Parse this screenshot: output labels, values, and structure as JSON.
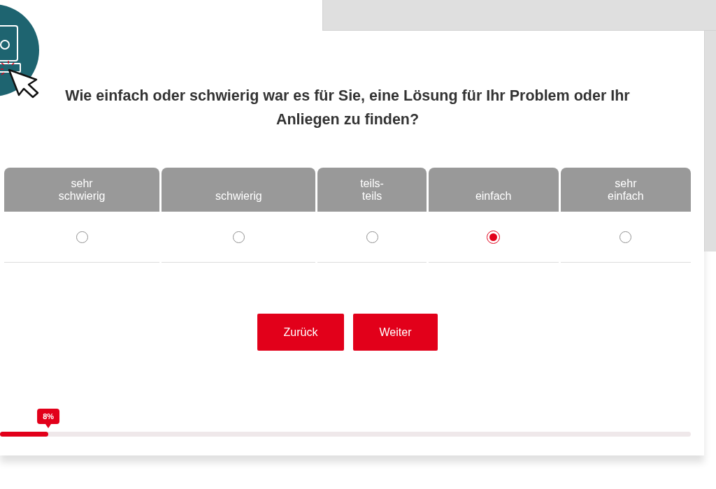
{
  "question": "Wie einfach oder schwierig war es für Sie, eine Lösung für Ihr Problem oder Ihr Anliegen zu finden?",
  "scale": [
    {
      "label": "sehr\nschwierig",
      "selected": false
    },
    {
      "label": "schwierig",
      "selected": false
    },
    {
      "label": "teils-\nteils",
      "selected": false
    },
    {
      "label": "einfach",
      "selected": true
    },
    {
      "label": "sehr\neinfach",
      "selected": false
    }
  ],
  "buttons": [
    {
      "label": "Zurück"
    },
    {
      "label": "Weiter"
    }
  ],
  "progress": {
    "level": 0.07,
    "reading": "8%"
  }
}
